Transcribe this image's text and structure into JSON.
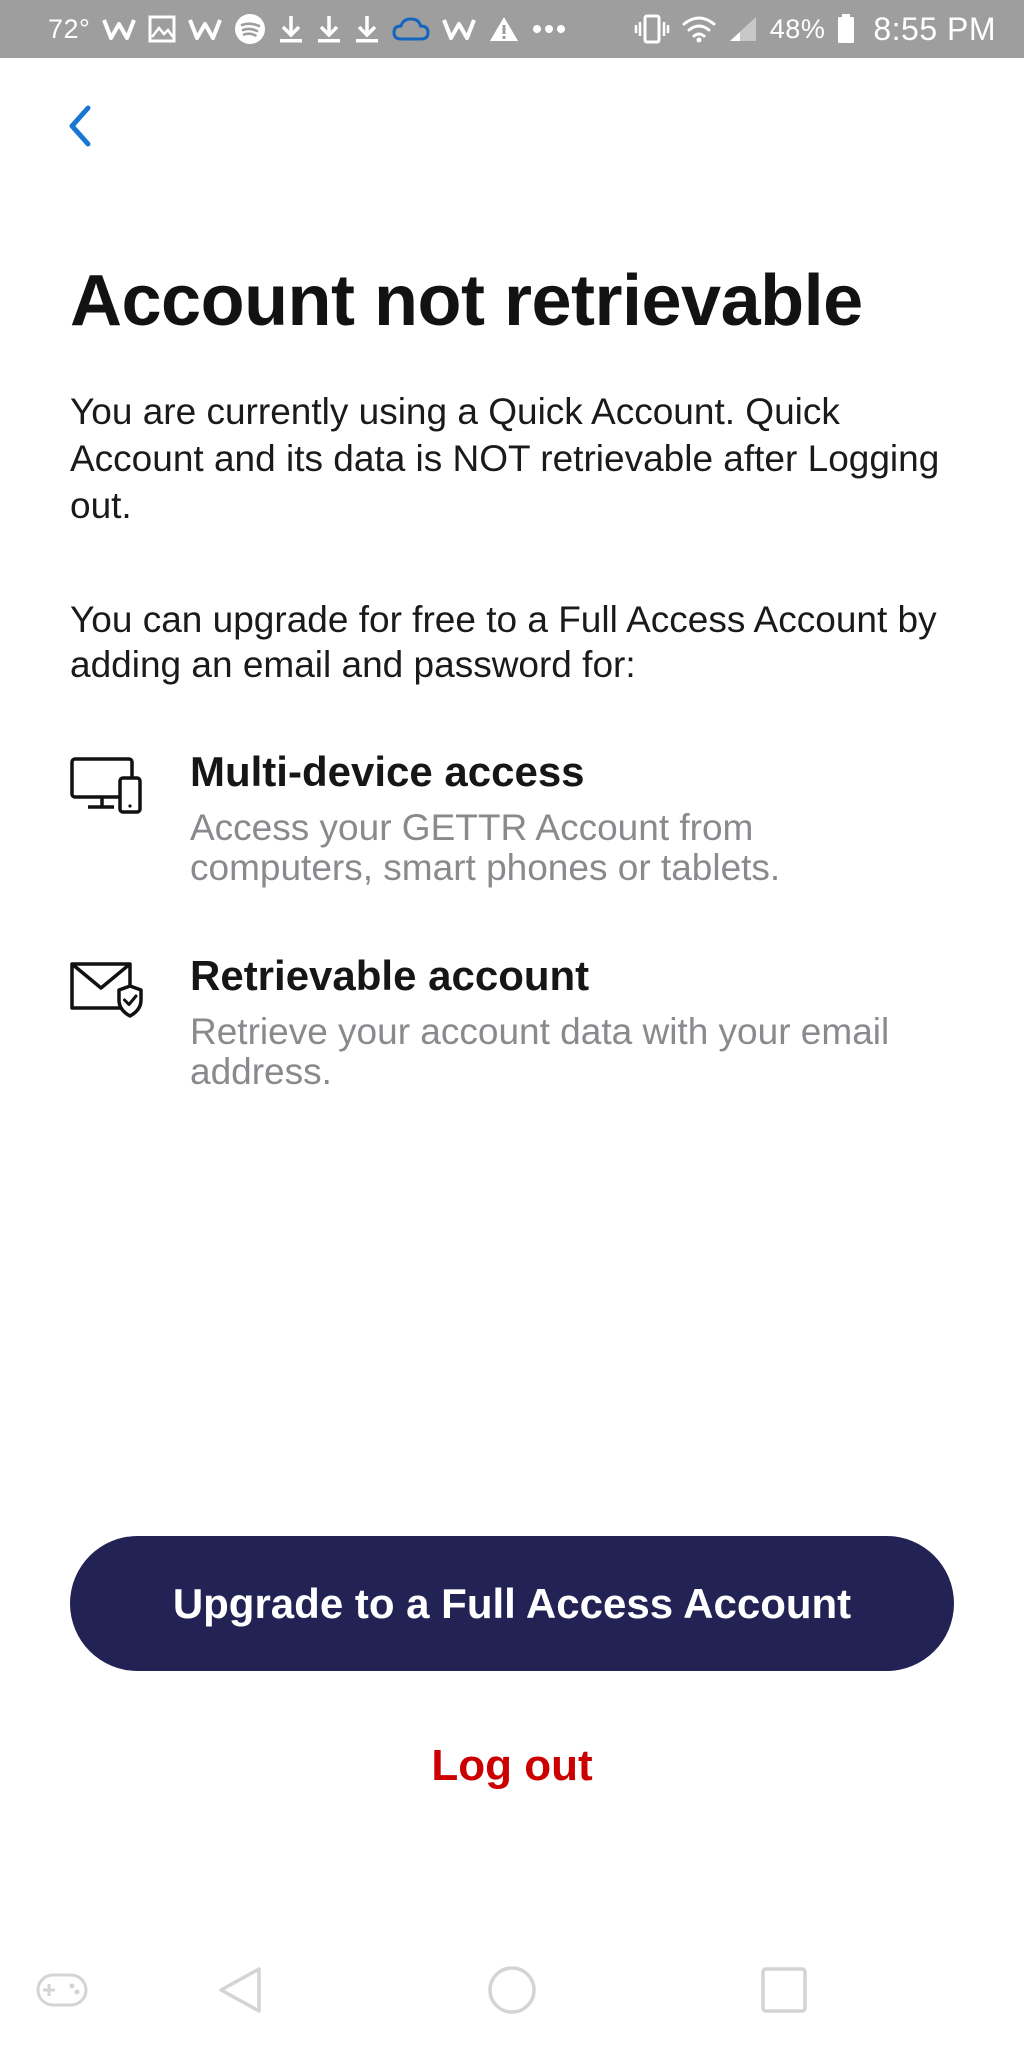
{
  "status_bar": {
    "temperature": "72°",
    "battery": "48%",
    "time": "8:55 PM",
    "icons": [
      "w-app-icon",
      "image-icon",
      "w-app-icon",
      "spotify-icon",
      "download-icon",
      "download-icon",
      "download-icon",
      "cloud-icon",
      "w-app-icon",
      "warning-icon",
      "more-icon",
      "vibrate-icon",
      "wifi-icon",
      "signal-icon",
      "battery-icon"
    ]
  },
  "header": {
    "back_icon": "chevron-left-icon"
  },
  "page": {
    "title": "Account not retrievable",
    "intro": "You are currently using a Quick Account. Quick Account and its data is NOT retrievable after Logging out.",
    "upgrade_intro": "You can upgrade for free to a Full Access Account by adding an email and password for:"
  },
  "features": [
    {
      "icon": "devices-icon",
      "title": "Multi-device access",
      "description": "Access your GETTR Account from computers, smart phones or tablets."
    },
    {
      "icon": "mail-shield-icon",
      "title": "Retrievable account",
      "description": "Retrieve your account data with your email address."
    }
  ],
  "actions": {
    "upgrade_label": "Upgrade to a Full Access Account",
    "logout_label": "Log out"
  },
  "nav_bar": {
    "icons": [
      "gamepad-icon",
      "back-triangle-icon",
      "home-circle-icon",
      "recents-square-icon"
    ]
  },
  "colors": {
    "accent_blue": "#1976d2",
    "primary_button": "#222255",
    "logout_red": "#cc0000",
    "status_bar_bg": "#9e9e9e",
    "secondary_text": "#8a8a8e"
  }
}
